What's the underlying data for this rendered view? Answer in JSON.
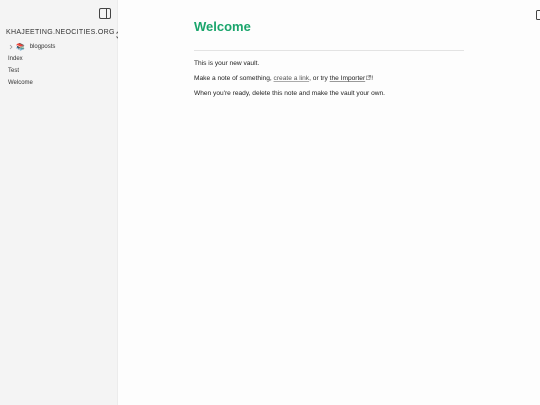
{
  "sidebar": {
    "vault_name": "KHAJEETING.NEOCITIES.ORG",
    "tree": {
      "folder": {
        "icon": "books-icon",
        "glyph": "📚",
        "label": "blogposts"
      },
      "files": [
        {
          "label": "Index"
        },
        {
          "label": "Test"
        },
        {
          "label": "Welcome"
        }
      ]
    }
  },
  "note": {
    "title": "Welcome",
    "p1": "This is your new vault.",
    "p2_before": "Make a note of something, ",
    "p2_link1": "create a link",
    "p2_middle": ", or try ",
    "p2_link2": "the Importer",
    "p2_after": "!",
    "p3": "When you're ready, delete this note and make the vault your own."
  },
  "colors": {
    "title_accent": "#1aa56c",
    "sidebar_bg": "#f4f4f4"
  }
}
